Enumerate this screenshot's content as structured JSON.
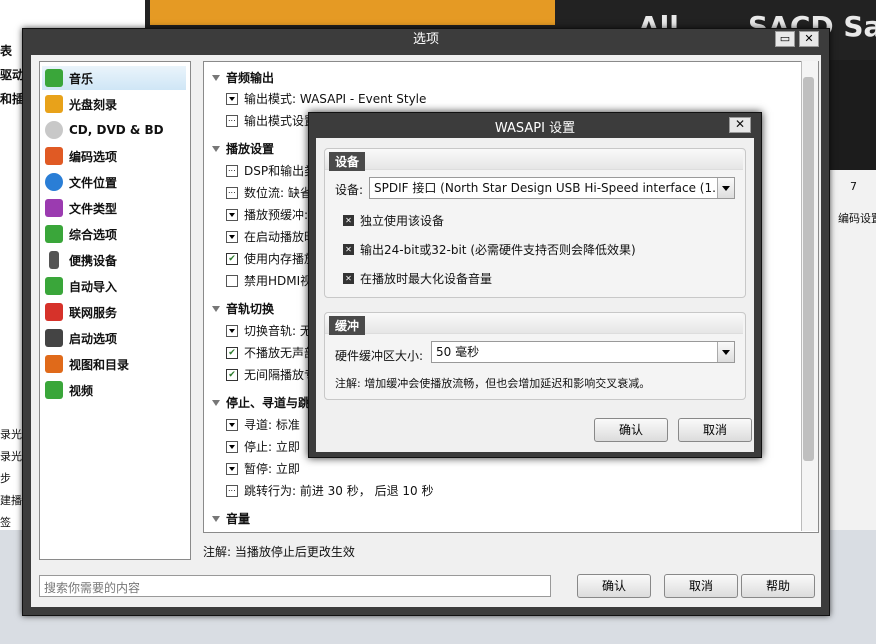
{
  "background": {
    "left_bold_lines": [
      "表",
      "驱动",
      "和插"
    ],
    "left_small_lines": [
      "录光盘",
      "录光盘",
      "步",
      "建播放",
      "签"
    ],
    "top_right_text": "All",
    "top_right_text2": "SACD Sa",
    "right_panel_tab": "7",
    "right_panel_label": "编码设置"
  },
  "dialog": {
    "title": "选项",
    "min_label": "▭",
    "close_label": "✕",
    "nav": [
      {
        "label": "音乐",
        "icon": "music-icon",
        "color": "#3aa63a",
        "selected": true
      },
      {
        "label": "光盘刻录",
        "icon": "disc-burn-icon",
        "color": "#e8a21a"
      },
      {
        "label": "CD, DVD & BD",
        "icon": "disc-icon",
        "color": "#c8c8c8"
      },
      {
        "label": "编码选项",
        "icon": "encode-icon",
        "color": "#e05a24"
      },
      {
        "label": "文件位置",
        "icon": "compass-icon",
        "color": "#2a7ed6"
      },
      {
        "label": "文件类型",
        "icon": "puzzle-icon",
        "color": "#9b3bb0"
      },
      {
        "label": "综合选项",
        "icon": "check-icon",
        "color": "#3aa63a"
      },
      {
        "label": "便携设备",
        "icon": "device-icon",
        "color": "#555555"
      },
      {
        "label": "自动导入",
        "icon": "import-icon",
        "color": "#3aa63a"
      },
      {
        "label": "联网服务",
        "icon": "network-icon",
        "color": "#d6322a"
      },
      {
        "label": "启动选项",
        "icon": "startup-icon",
        "color": "#444444"
      },
      {
        "label": "视图和目录",
        "icon": "view-icon",
        "color": "#e06a1a"
      },
      {
        "label": "视频",
        "icon": "video-icon",
        "color": "#3aa63a"
      }
    ],
    "sections": {
      "audio_output": {
        "title": "音频输出",
        "items": [
          "输出模式: WASAPI - Event Style",
          "输出模式设置"
        ]
      },
      "playback": {
        "title": "播放设置",
        "items": [
          "DSP和输出类",
          "数位流: 缺省",
          "播放预缓冲:",
          "在启动播放时",
          "使用内存播放",
          "禁用HDMI视"
        ]
      },
      "track_switch": {
        "title": "音轨切换",
        "items": [
          "切换音轨: 无",
          "不播放无声部",
          "无间隔播放专"
        ]
      },
      "stop_seek": {
        "title": "停止、寻道与跳",
        "items": [
          "寻道: 标准",
          "停止: 立即",
          "暂停: 立即",
          "跳转行为: 前进 30 秒， 后退 10 秒"
        ]
      },
      "volume": {
        "title": "音量"
      }
    },
    "note": "注解: 当播放停止后更改生效",
    "search_placeholder": "搜索你需要的内容",
    "ok": "确认",
    "cancel": "取消",
    "help": "帮助"
  },
  "wasapi": {
    "title": "WASAPI 设置",
    "close_label": "✕",
    "device_group": "设备",
    "device_label": "设备:",
    "device_value": "SPDIF 接口 (North Star Design USB Hi-Speed interface (1...",
    "checks": [
      "独立使用该设备",
      "输出24-bit或32-bit (必需硬件支持否则会降低效果)",
      "在播放时最大化设备音量"
    ],
    "buffer_group": "缓冲",
    "buffer_label": "硬件缓冲区大小:",
    "buffer_value": "50 毫秒",
    "buffer_note": "注解: 增加缓冲会使播放流畅，但也会增加延迟和影响交叉衰减。",
    "ok": "确认",
    "cancel": "取消"
  }
}
